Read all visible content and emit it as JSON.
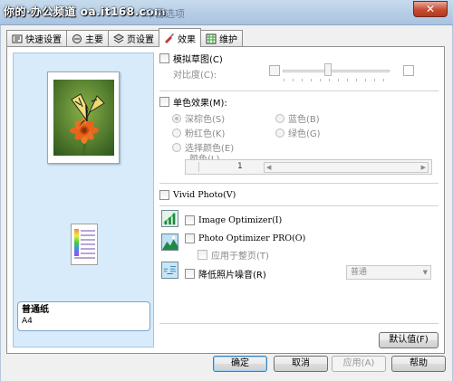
{
  "window": {
    "watermark": "你的·办公频道 oa.it168.com",
    "title_suffix": "印首选项",
    "close_glyph": "✕"
  },
  "tabs": [
    {
      "label": "快速设置",
      "icon": "quick-setup-icon"
    },
    {
      "label": "主要",
      "icon": "main-icon"
    },
    {
      "label": "页设置",
      "icon": "page-setup-icon"
    },
    {
      "label": "效果",
      "icon": "effects-icon",
      "active": true
    },
    {
      "label": "维护",
      "icon": "maintenance-icon"
    }
  ],
  "preview": {
    "media_type": "普通纸",
    "media_size": "A4"
  },
  "effects": {
    "simulate_sketch": "模拟草图(C)",
    "contrast": "对比度(C):",
    "monochrome": "单色效果(M):",
    "sepia": "深棕色(S)",
    "blue": "蓝色(B)",
    "pink": "粉红色(K)",
    "green": "绿色(G)",
    "select_color": "选择颜色(E)",
    "color_label": "颜色(L)",
    "color_value": "1",
    "vivid_photo": "Vivid Photo(V)",
    "image_optimizer": "Image Optimizer(I)",
    "photo_optimizer_pro": "Photo Optimizer PRO(O)",
    "apply_to_whole_page": "应用于整页(T)",
    "noise_reduction": "降低照片噪音(R)",
    "noise_value": "普通",
    "defaults_button": "默认值(F)"
  },
  "buttons": {
    "ok": "确定",
    "cancel": "取消",
    "apply": "应用(A)",
    "help": "帮助"
  },
  "colors": {
    "accent": "#3c7fb1",
    "preview_bg": "#d7ebfa",
    "close": "#c84b32"
  }
}
